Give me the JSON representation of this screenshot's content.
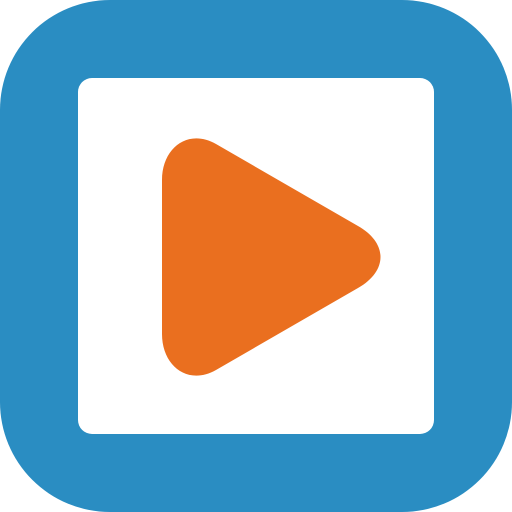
{
  "icon": {
    "name": "play-app-icon",
    "frame_color": "#2A8DC2",
    "inner_color": "#FFFFFF",
    "play_color": "#EA6F1F"
  }
}
